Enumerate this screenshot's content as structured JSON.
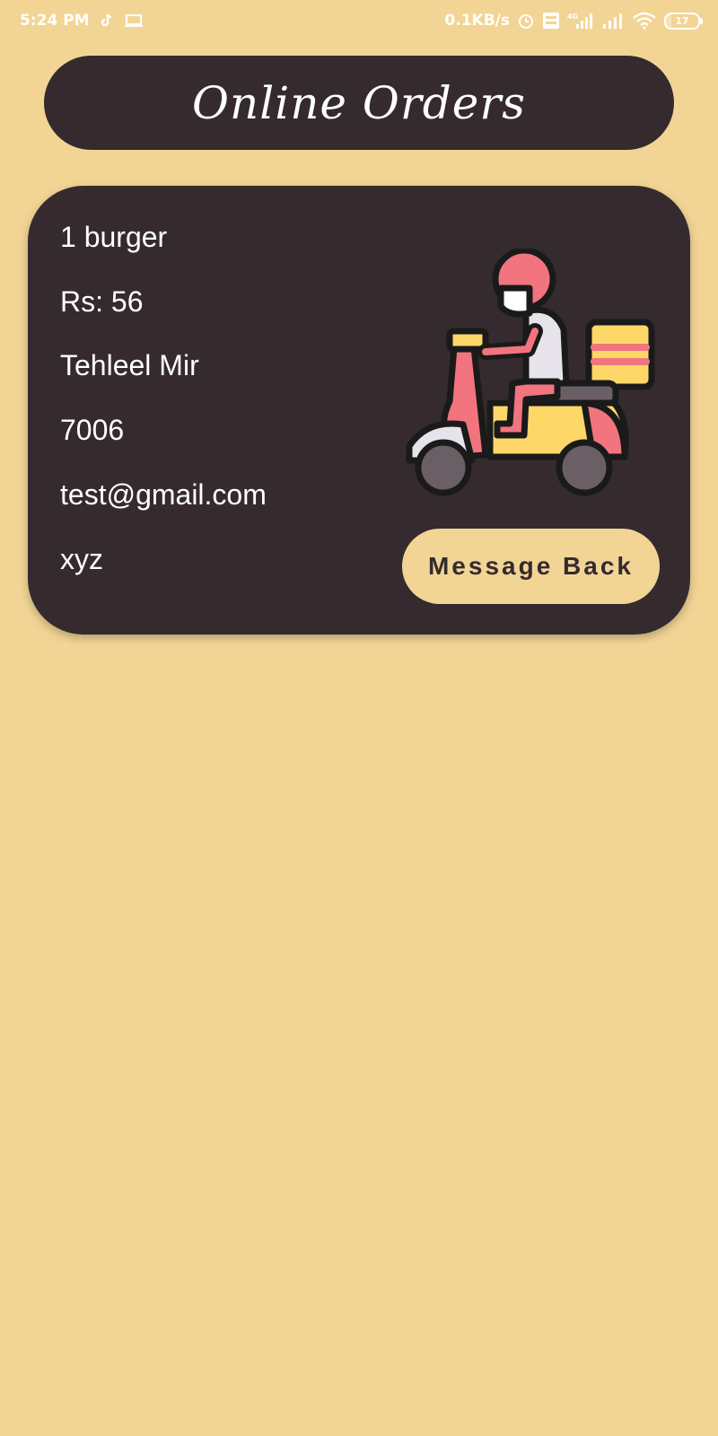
{
  "status_bar": {
    "time": "5:24 PM",
    "speed": "0.1KB/s",
    "battery": "17",
    "icons": [
      "tiktok-icon",
      "laptop-icon",
      "alarm-icon",
      "volte-icon",
      "signal-icon",
      "signal-icon",
      "wifi-icon",
      "battery-icon"
    ]
  },
  "header": {
    "title": "Online Orders"
  },
  "order": {
    "item": "1 burger",
    "price": "Rs: 56",
    "name": "Tehleel Mir",
    "phone": "7006",
    "email": "test@gmail.com",
    "address": "xyz",
    "illustration": "delivery-scooter-icon",
    "button_label": "Message Back"
  },
  "colors": {
    "background": "#F2D595",
    "card": "#352B2E",
    "accent_red": "#F1747E",
    "accent_yellow": "#FDD869"
  }
}
